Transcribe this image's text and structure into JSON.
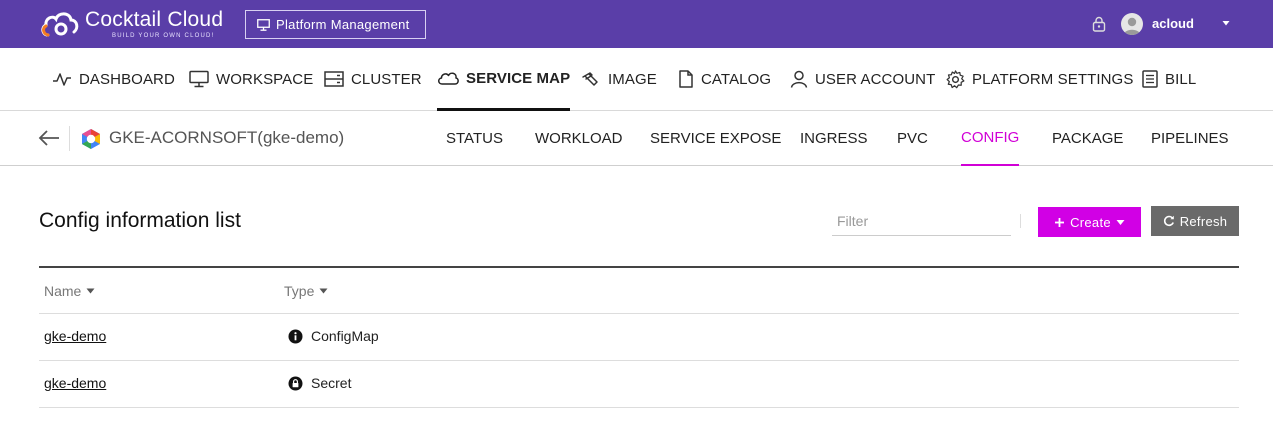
{
  "topbar": {
    "brand": "Cocktail Cloud",
    "tagline": "BUILD YOUR OWN CLOUD!",
    "platform_button": "Platform Management",
    "username": "acloud",
    "colors": {
      "background": "#5a3ea8",
      "logo_accent": "#f47c20"
    }
  },
  "main_nav": {
    "items": [
      {
        "label": "DASHBOARD",
        "icon": "pulse-icon"
      },
      {
        "label": "WORKSPACE",
        "icon": "monitor-icon"
      },
      {
        "label": "CLUSTER",
        "icon": "server-icon"
      },
      {
        "label": "SERVICE MAP",
        "icon": "cloud-icon",
        "active": true
      },
      {
        "label": "IMAGE",
        "icon": "wrench-icon"
      },
      {
        "label": "CATALOG",
        "icon": "document-icon"
      },
      {
        "label": "USER ACCOUNT",
        "icon": "user-icon"
      },
      {
        "label": "PLATFORM SETTINGS",
        "icon": "gear-icon"
      },
      {
        "label": "BILL",
        "icon": "receipt-icon"
      }
    ]
  },
  "cluster": {
    "name": "GKE-ACORNSOFT(gke-demo)"
  },
  "sub_tabs": {
    "items": [
      {
        "label": "STATUS"
      },
      {
        "label": "WORKLOAD"
      },
      {
        "label": "SERVICE EXPOSE"
      },
      {
        "label": "INGRESS"
      },
      {
        "label": "PVC"
      },
      {
        "label": "CONFIG",
        "active": true
      },
      {
        "label": "PACKAGE"
      },
      {
        "label": "PIPELINES"
      }
    ],
    "active_color": "#d100d6"
  },
  "content": {
    "title": "Config information list",
    "filter_placeholder": "Filter",
    "create_label": "Create",
    "refresh_label": "Refresh",
    "create_color": "#d100e5",
    "refresh_color": "#6a6a6a"
  },
  "table": {
    "columns": [
      {
        "label": "Name"
      },
      {
        "label": "Type"
      }
    ],
    "rows": [
      {
        "name": "gke-demo",
        "type": "ConfigMap",
        "type_icon": "info-icon"
      },
      {
        "name": "gke-demo",
        "type": "Secret",
        "type_icon": "lock-icon"
      }
    ]
  }
}
